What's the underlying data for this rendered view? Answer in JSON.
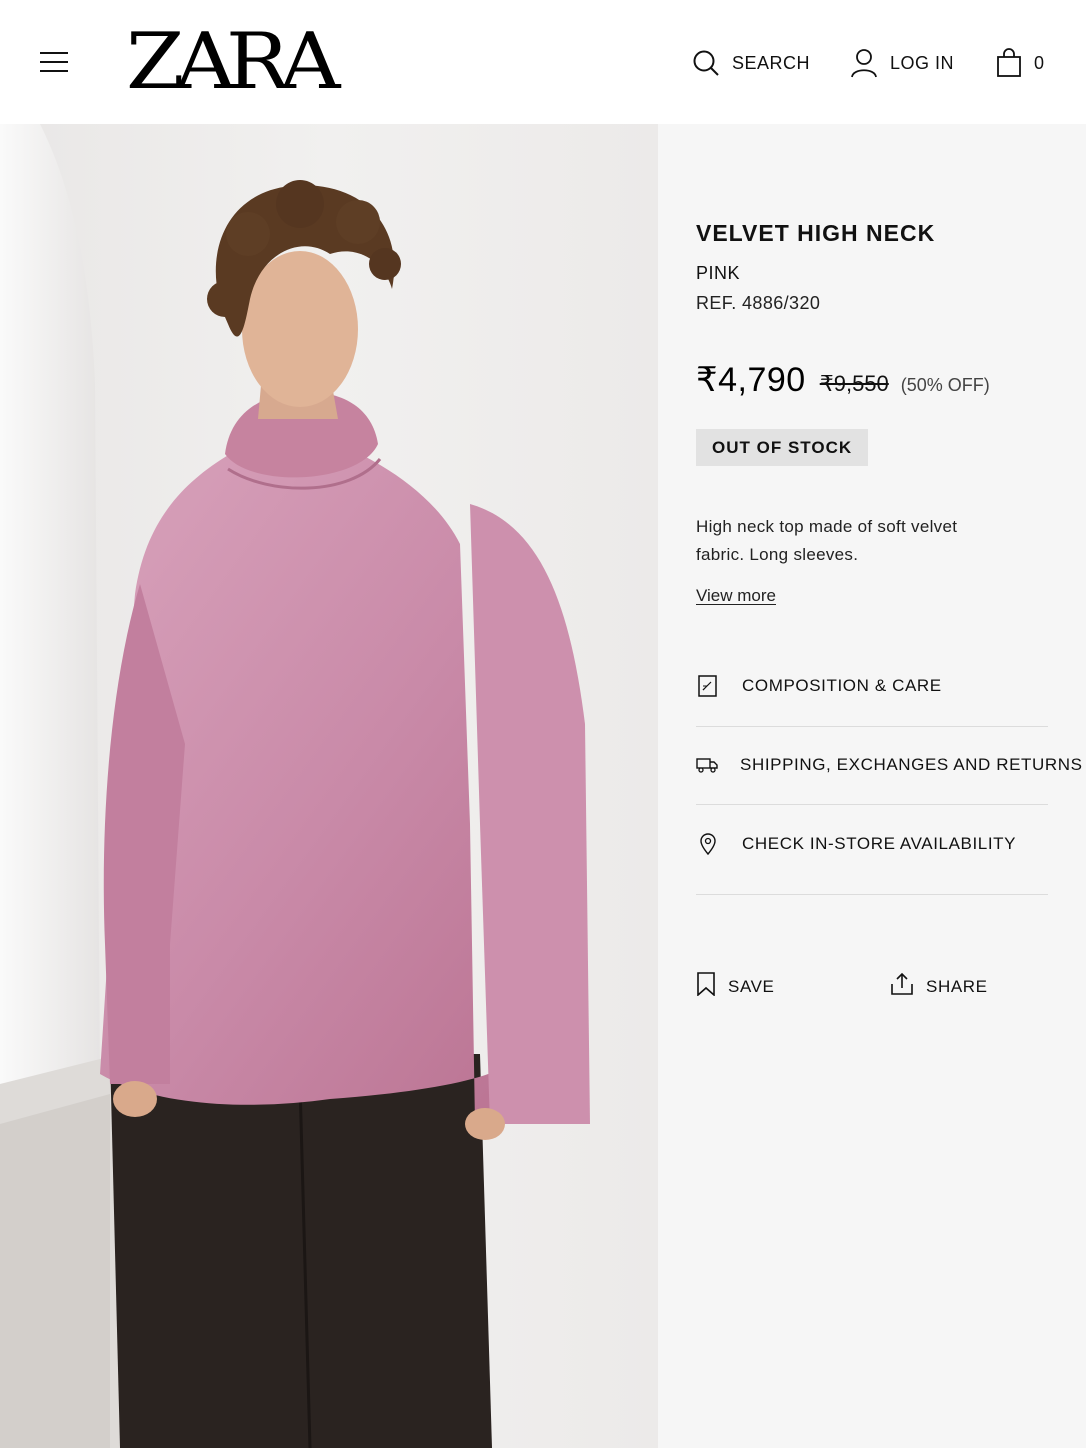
{
  "header": {
    "logo": "ZARA",
    "search_label": "SEARCH",
    "login_label": "LOG IN",
    "cart_count": "0"
  },
  "product": {
    "name": "VELVET HIGH NECK",
    "color": "PINK",
    "ref": "REF. 4886/320",
    "price": "₹4,790",
    "old_price": "₹9,550",
    "discount": "(50% OFF)",
    "stock_status": "OUT OF STOCK",
    "description": "High neck top made of soft velvet fabric. Long sleeves.",
    "view_more": "View more"
  },
  "accordion": [
    {
      "label": "COMPOSITION & CARE",
      "icon": "composition-tag-icon"
    },
    {
      "label": "SHIPPING, EXCHANGES AND RETURNS",
      "icon": "truck-icon"
    },
    {
      "label": "CHECK IN-STORE AVAILABILITY",
      "icon": "location-pin-icon"
    }
  ],
  "actions": {
    "save_label": "SAVE",
    "share_label": "SHARE"
  },
  "colors": {
    "sweater_pink": "#c98aa8",
    "trousers": "#2a2320",
    "info_bg": "#f6f6f6",
    "badge_bg": "#e2e2e2"
  }
}
